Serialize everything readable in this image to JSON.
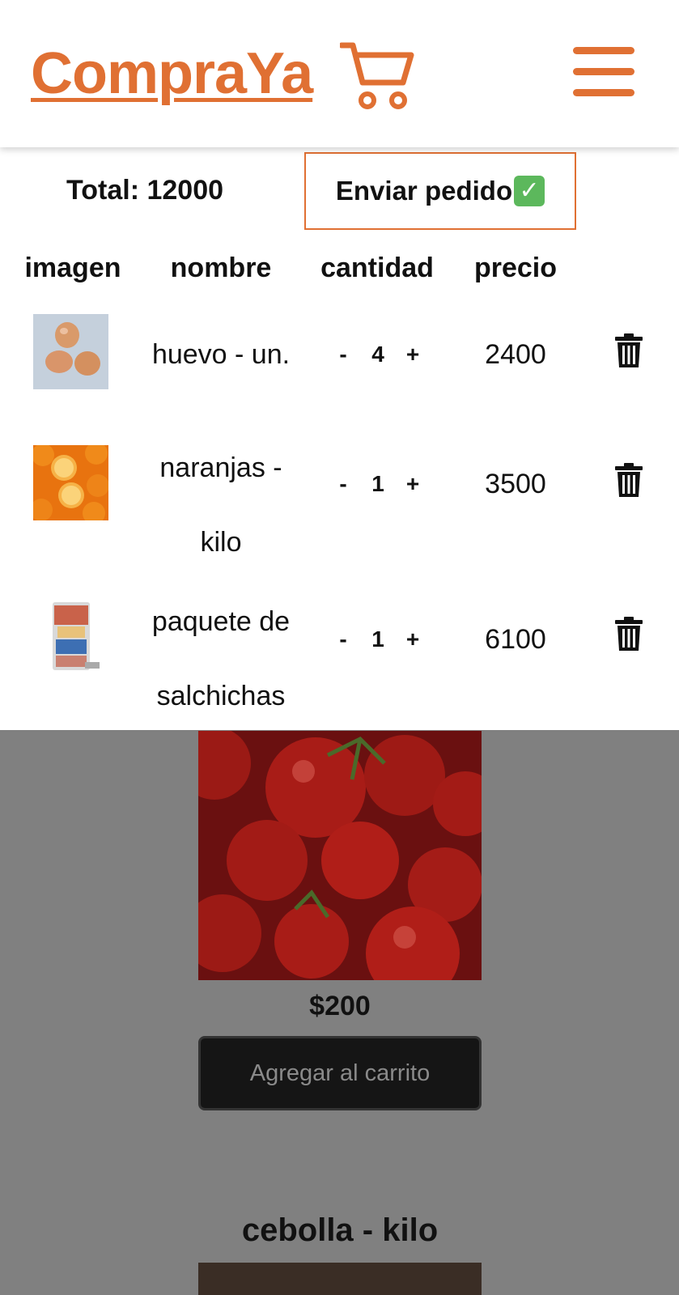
{
  "app": {
    "brand": "CompraYa",
    "accent_color": "#e07033",
    "icons": [
      "cart-icon",
      "menu-icon"
    ]
  },
  "cart": {
    "total_text": "Total: 12000",
    "send_button": "Enviar pedido",
    "send_icon": "check-mark-icon",
    "columns": [
      "imagen",
      "nombre",
      "cantidad",
      "precio"
    ],
    "items": [
      {
        "name_lines": [
          "huevo - un."
        ],
        "minus": "-",
        "qty": "4",
        "plus": "+",
        "price": "2400",
        "image": "eggs-photo"
      },
      {
        "name_lines": [
          "naranjas -",
          "kilo"
        ],
        "minus": "-",
        "qty": "1",
        "plus": "+",
        "price": "3500",
        "image": "oranges-photo"
      },
      {
        "name_lines": [
          "paquete de",
          "salchichas"
        ],
        "minus": "-",
        "qty": "1",
        "plus": "+",
        "price": "6100",
        "image": "sausage-pack-photo"
      }
    ]
  },
  "background_product": {
    "image": "tomatoes-photo",
    "price": "$200",
    "button": "Agregar al carrito"
  },
  "next_product": {
    "title": "cebolla - kilo"
  }
}
